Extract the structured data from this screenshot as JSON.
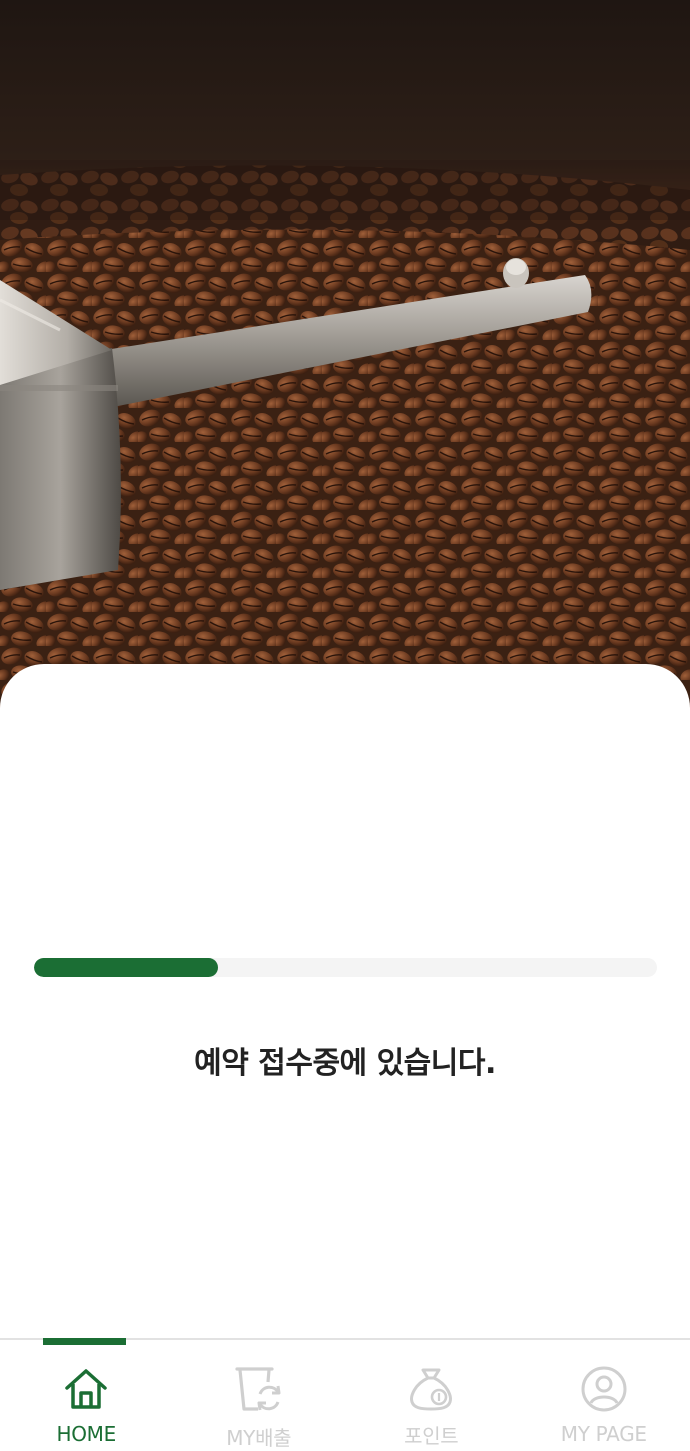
{
  "progress": {
    "fraction": 0.295,
    "fill_color": "#1b6e34",
    "track_color": "#f4f4f4"
  },
  "status_message": "예약 접수중에 있습니다.",
  "hero": {
    "subject": "coffee beans with metal scoop",
    "icon": "coffee-roaster-photo"
  },
  "bottom_nav": {
    "active_color": "#1b6e34",
    "inactive_color": "#cfcfcf",
    "items": [
      {
        "label": "HOME",
        "icon": "home-icon",
        "active": true
      },
      {
        "label": "MY배출",
        "icon": "recycle-bin-icon",
        "active": false
      },
      {
        "label": "포인트",
        "icon": "money-bag-icon",
        "active": false
      },
      {
        "label": "MY PAGE",
        "icon": "user-circle-icon",
        "active": false
      }
    ]
  }
}
